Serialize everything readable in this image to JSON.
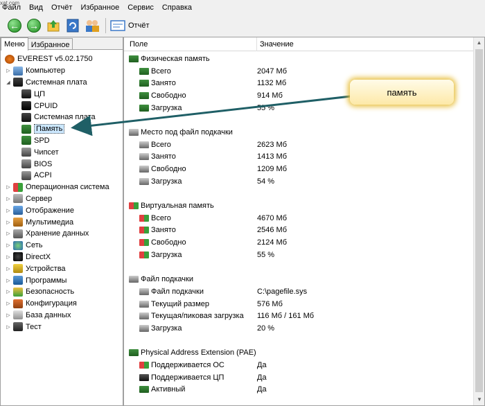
{
  "watermark": "xat.com",
  "menu": [
    "Файл",
    "Вид",
    "Отчёт",
    "Избранное",
    "Сервис",
    "Справка"
  ],
  "toolbar": {
    "report_label": "Отчёт"
  },
  "left_tabs": [
    "Меню",
    "Избранное"
  ],
  "tree": [
    {
      "label": "EVEREST v5.02.1750",
      "level": 0,
      "icon": "info-icon",
      "expander": ""
    },
    {
      "label": "Компьютер",
      "level": 1,
      "icon": "computer-icon",
      "expander": "▷"
    },
    {
      "label": "Системная плата",
      "level": 1,
      "icon": "motherboard-icon",
      "expander": "◢"
    },
    {
      "label": "ЦП",
      "level": 2,
      "icon": "cpu-icon",
      "expander": ""
    },
    {
      "label": "CPUID",
      "level": 2,
      "icon": "cpuid-icon",
      "expander": ""
    },
    {
      "label": "Системная плата",
      "level": 2,
      "icon": "motherboard-icon",
      "expander": ""
    },
    {
      "label": "Память",
      "level": 2,
      "icon": "ram-icon",
      "expander": "",
      "selected": true
    },
    {
      "label": "SPD",
      "level": 2,
      "icon": "ram-icon",
      "expander": ""
    },
    {
      "label": "Чипсет",
      "level": 2,
      "icon": "chip-icon",
      "expander": ""
    },
    {
      "label": "BIOS",
      "level": 2,
      "icon": "chip-icon",
      "expander": ""
    },
    {
      "label": "ACPI",
      "level": 2,
      "icon": "chip-icon",
      "expander": ""
    },
    {
      "label": "Операционная система",
      "level": 1,
      "icon": "windows-icon",
      "expander": "▷"
    },
    {
      "label": "Сервер",
      "level": 1,
      "icon": "server-icon",
      "expander": "▷"
    },
    {
      "label": "Отображение",
      "level": 1,
      "icon": "display-icon",
      "expander": "▷"
    },
    {
      "label": "Мультимедиа",
      "level": 1,
      "icon": "multimedia-icon",
      "expander": "▷"
    },
    {
      "label": "Хранение данных",
      "level": 1,
      "icon": "storage-icon",
      "expander": "▷"
    },
    {
      "label": "Сеть",
      "level": 1,
      "icon": "network-icon",
      "expander": "▷"
    },
    {
      "label": "DirectX",
      "level": 1,
      "icon": "directx-icon",
      "expander": "▷"
    },
    {
      "label": "Устройства",
      "level": 1,
      "icon": "devices-icon",
      "expander": "▷"
    },
    {
      "label": "Программы",
      "level": 1,
      "icon": "programs-icon",
      "expander": "▷"
    },
    {
      "label": "Безопасность",
      "level": 1,
      "icon": "security-icon",
      "expander": "▷"
    },
    {
      "label": "Конфигурация",
      "level": 1,
      "icon": "config-icon",
      "expander": "▷"
    },
    {
      "label": "База данных",
      "level": 1,
      "icon": "database-icon",
      "expander": "▷"
    },
    {
      "label": "Тест",
      "level": 1,
      "icon": "hourglass-icon",
      "expander": "▷"
    }
  ],
  "columns": {
    "field": "Поле",
    "value": "Значение"
  },
  "groups": [
    {
      "title": "Физическая память",
      "icon": "ram-icon",
      "rows": [
        {
          "field": "Всего",
          "value": "2047 Мб"
        },
        {
          "field": "Занято",
          "value": "1132 Мб"
        },
        {
          "field": "Свободно",
          "value": "914 Мб"
        },
        {
          "field": "Загрузка",
          "value": "55 %"
        }
      ]
    },
    {
      "title": "Место под файл подкачки",
      "icon": "disk-icon",
      "rows": [
        {
          "field": "Всего",
          "value": "2623 Мб"
        },
        {
          "field": "Занято",
          "value": "1413 Мб"
        },
        {
          "field": "Свободно",
          "value": "1209 Мб"
        },
        {
          "field": "Загрузка",
          "value": "54 %"
        }
      ]
    },
    {
      "title": "Виртуальная память",
      "icon": "windows-icon",
      "rows": [
        {
          "field": "Всего",
          "value": "4670 Мб"
        },
        {
          "field": "Занято",
          "value": "2546 Мб"
        },
        {
          "field": "Свободно",
          "value": "2124 Мб"
        },
        {
          "field": "Загрузка",
          "value": "55 %"
        }
      ]
    },
    {
      "title": "Файл подкачки",
      "icon": "disk-icon",
      "rows": [
        {
          "field": "Файл подкачки",
          "value": "C:\\pagefile.sys"
        },
        {
          "field": "Текущий размер",
          "value": "576 Мб"
        },
        {
          "field": "Текущая/пиковая загрузка",
          "value": "116 Мб / 161 Мб"
        },
        {
          "field": "Загрузка",
          "value": "20 %"
        }
      ]
    },
    {
      "title": "Physical Address Extension (PAE)",
      "icon": "ram-icon",
      "rows": [
        {
          "field": "Поддерживается ОС",
          "value": "Да",
          "icon": "windows-icon"
        },
        {
          "field": "Поддерживается ЦП",
          "value": "Да",
          "icon": "cpu-icon"
        },
        {
          "field": "Активный",
          "value": "Да",
          "icon": "ram-icon"
        }
      ]
    }
  ],
  "callout": {
    "text": "память"
  },
  "colors": {
    "selection": "#cce8ff",
    "arrow": "#1f5f66",
    "callout_glow": "#e8c040"
  }
}
